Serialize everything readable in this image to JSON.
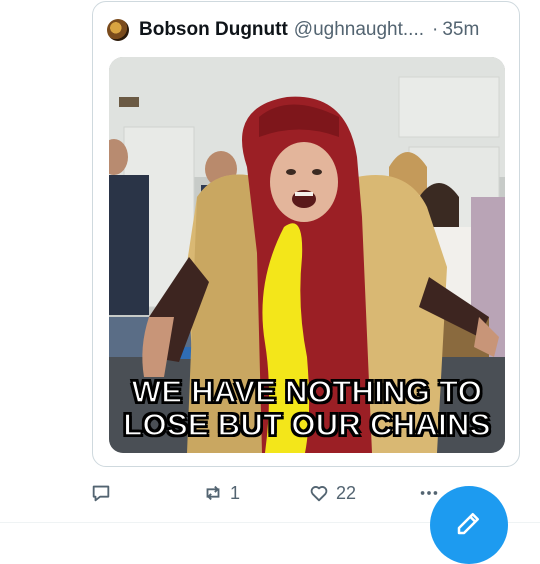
{
  "quote": {
    "display_name": "Bobson Dugnutt",
    "handle": "@ughnaught....",
    "separator": "·",
    "time": "35m",
    "media": {
      "caption_line1": "WE HAVE NOTHING TO",
      "caption_line2": "LOSE BUT OUR CHAINS"
    }
  },
  "actions": {
    "reply_icon": "reply-icon",
    "repost_icon": "repost-icon",
    "repost_count": "1",
    "like_icon": "heart-icon",
    "like_count": "22",
    "more_icon": "more-icon"
  },
  "fab": {
    "icon": "compose-icon",
    "color": "#1d9bf0"
  }
}
